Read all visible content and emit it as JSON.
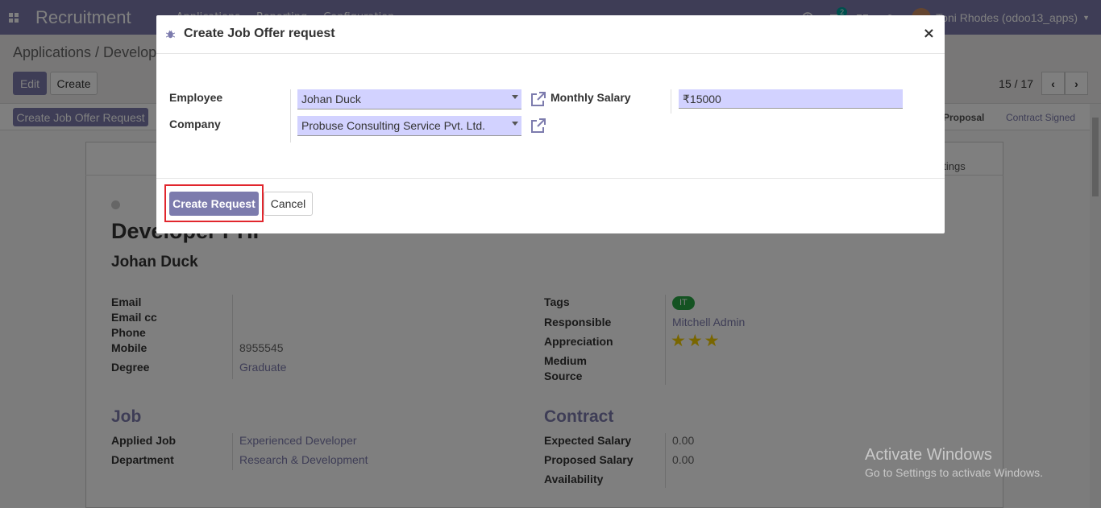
{
  "navbar": {
    "app_title": "Recruitment",
    "menu": [
      "Applications",
      "Reporting",
      "Configuration"
    ],
    "message_count": "2",
    "user_name": "Toni Rhodes (odoo13_apps)"
  },
  "control": {
    "breadcrumb": "Applications / Develop",
    "edit_label": "Edit",
    "create_label": "Create",
    "pager": "15 / 17"
  },
  "statusbar": {
    "offer_button": "Create Job Offer Request",
    "stages": [
      "Proposal",
      "Contract Signed"
    ]
  },
  "sheet": {
    "meetings_fragment": "etings",
    "job_title_partial": "Developer PHP",
    "applicant": "Johan Duck",
    "left_fields": [
      {
        "label": "Email",
        "value": ""
      },
      {
        "label": "Email cc",
        "value": ""
      },
      {
        "label": "Phone",
        "value": ""
      },
      {
        "label": "Mobile",
        "value": "8955545"
      },
      {
        "label": "Degree",
        "value": "Graduate"
      }
    ],
    "right_fields": [
      {
        "label": "Tags",
        "value": "IT"
      },
      {
        "label": "Responsible",
        "value": "Mitchell Admin"
      },
      {
        "label": "Appreciation",
        "value": "★★★"
      },
      {
        "label": "Medium",
        "value": ""
      },
      {
        "label": "Source",
        "value": ""
      }
    ],
    "job_section": "Job",
    "job_fields": [
      {
        "label": "Applied Job",
        "value": "Experienced Developer"
      },
      {
        "label": "Department",
        "value": "Research & Development"
      }
    ],
    "contract_section": "Contract",
    "contract_fields": [
      {
        "label": "Expected Salary",
        "value": "0.00"
      },
      {
        "label": "Proposed Salary",
        "value": "0.00"
      },
      {
        "label": "Availability",
        "value": ""
      }
    ]
  },
  "watermark": {
    "title": "Activate Windows",
    "subtitle": "Go to Settings to activate Windows."
  },
  "modal": {
    "title": "Create Job Offer request",
    "close": "×",
    "employee_label": "Employee",
    "employee_value": "Johan Duck",
    "company_label": "Company",
    "company_value": "Probuse Consulting Service Pvt. Ltd.",
    "salary_label": "Monthly Salary",
    "salary_value": "₹15000",
    "create_button": "Create Request",
    "cancel_button": "Cancel"
  },
  "colors": {
    "brand": "#7c7bad",
    "field_bg": "#d2d2ff",
    "highlight": "#e1262d"
  }
}
